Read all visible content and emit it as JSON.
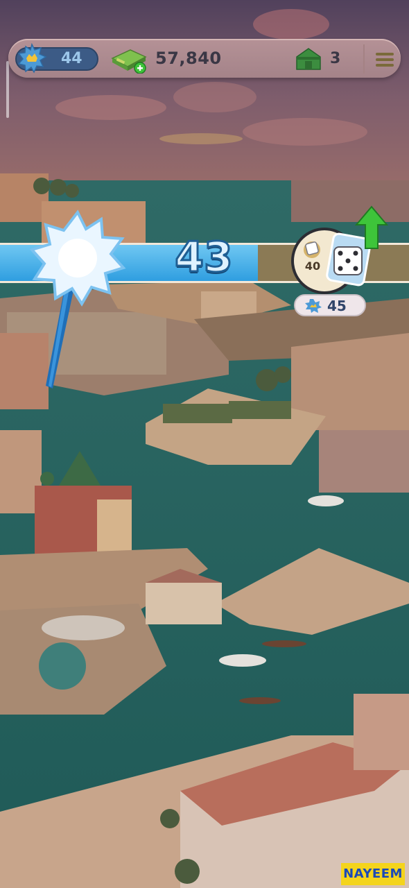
{
  "hud": {
    "level_value": "44",
    "cash_value": "57,840",
    "houses_value": "3",
    "icons": {
      "level": "blue-burst-level-icon",
      "cash": "money-stack-plus-icon",
      "house": "green-house-icon",
      "menu": "hamburger-menu-icon"
    }
  },
  "progress": {
    "current_value": "43",
    "fill_fraction": 0.63,
    "dice_count": "40",
    "reward_value": "45",
    "icons": {
      "burst": "white-star-burst-icon",
      "rocket": "blue-rocket-icon",
      "dice": "dice-icon",
      "upgrade": "green-arrow-up-icon"
    }
  },
  "watermark": "NAYEEM",
  "colors": {
    "band_fill": "#2f9ee0",
    "band_empty": "#8b7a55",
    "water": "#2a6a60",
    "accent_green": "#3ec43a"
  }
}
